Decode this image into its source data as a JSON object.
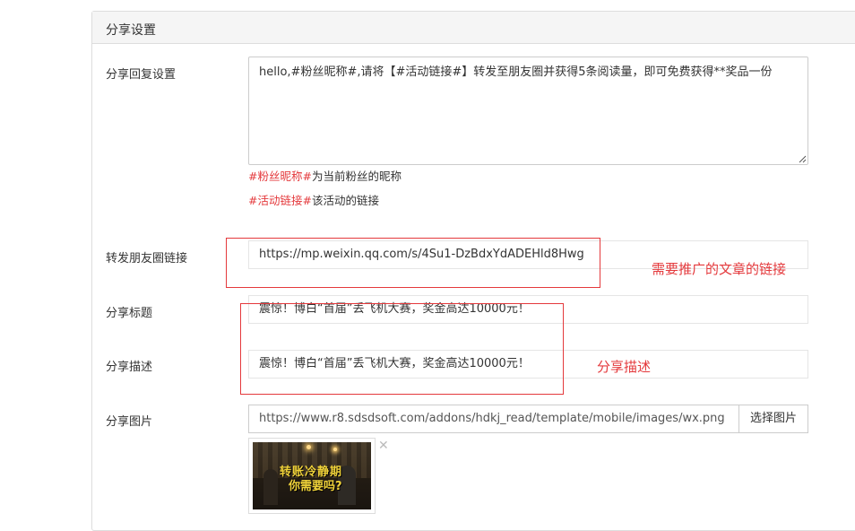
{
  "panel": {
    "title": "分享设置"
  },
  "fields": {
    "reply_label": "分享回复设置",
    "reply_value": "hello,#粉丝昵称#,请将【#活动链接#】转发至朋友圈并获得5条阅读量，即可免费获得**奖品一份",
    "hint1_tag": "#粉丝昵称#",
    "hint1_text": "为当前粉丝的昵称",
    "hint2_tag": "#活动链接#",
    "hint2_text": "该活动的链接",
    "link_label": "转发朋友圈链接",
    "link_value": "https://mp.weixin.qq.com/s/4Su1-DzBdxYdADEHld8Hwg",
    "title_label": "分享标题",
    "title_value": "震惊！博白“首届”丢飞机大赛，奖金高达10000元！",
    "desc_label": "分享描述",
    "desc_value": "震惊！博白“首届”丢飞机大赛，奖金高达10000元！",
    "image_label": "分享图片",
    "image_url": "https://www.r8.sdsdsoft.com/addons/hdkj_read/template/mobile/images/wx.png",
    "pick_image_button": "选择图片",
    "thumb_line1": "转账冷静期",
    "thumb_line2": "你需要吗?"
  },
  "annotations": {
    "link_note": "需要推广的文章的链接",
    "desc_note": "分享描述"
  },
  "colors": {
    "annotation_red": "#e4393c",
    "panel_header_bg": "#f5f5f5",
    "border": "#dddddd"
  },
  "icons": {
    "remove": "close-icon",
    "resize": "resize-grip-icon"
  }
}
